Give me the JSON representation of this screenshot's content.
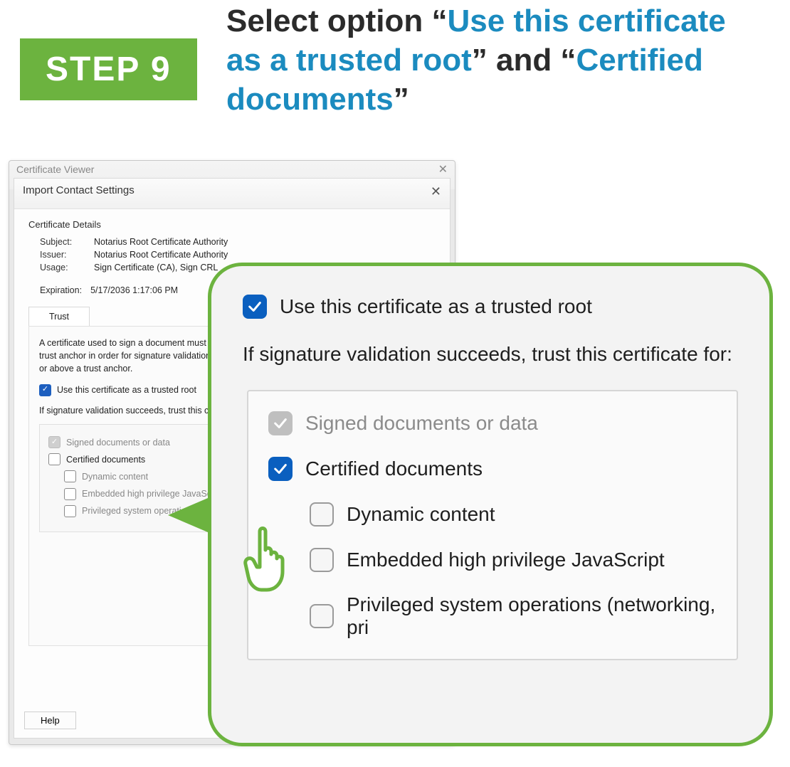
{
  "colors": {
    "brand_blue": "#1b8bbf",
    "step_green": "#6cb33f"
  },
  "step": {
    "label": "STEP 9"
  },
  "heading": {
    "prefix": "Select option “",
    "hl1": "Use this certificate as a trusted root",
    "mid": "” and “",
    "hl2": "Certified documents",
    "suffix": "”"
  },
  "outer_window": {
    "title": "Certificate Viewer"
  },
  "inner_window": {
    "title": "Import Contact Settings",
    "section_title": "Certificate Details",
    "labels": {
      "subject": "Subject:",
      "issuer": "Issuer:",
      "usage": "Usage:",
      "expiration": "Expiration:"
    },
    "subject": "Notarius Root Certificate Authority",
    "issuer": "Notarius Root Certificate Authority",
    "usage": "Sign Certificate (CA), Sign CRL",
    "expiration": "5/17/2036 1:17:06 PM",
    "tab": "Trust",
    "trust_intro": "A certificate used to sign a document must either be designated as a trust anchor or chain up to a trust anchor in order for signature validation to succeed. Revocation checking is not performed on or above a trust anchor.",
    "checkbox_trusted_root": "Use this certificate as a trusted root",
    "validation_line": "If signature validation succeeds, trust this certificate for:",
    "signed_docs": "Signed documents or data",
    "certified_docs": "Certified documents",
    "dynamic": "Dynamic content",
    "ehpjs": "Embedded high privilege JavaScript",
    "privileged": "Privileged system operations (networking, printing, file access, etc.)",
    "help": "Help"
  },
  "zoom": {
    "trusted_root": "Use this certificate as a trusted root",
    "validation_line": "If signature validation succeeds, trust this certificate for:",
    "signed_docs": "Signed documents or data",
    "certified_docs": "Certified documents",
    "dynamic": "Dynamic content",
    "ehpjs": "Embedded high privilege JavaScript",
    "privileged": "Privileged system operations (networking, pri"
  }
}
